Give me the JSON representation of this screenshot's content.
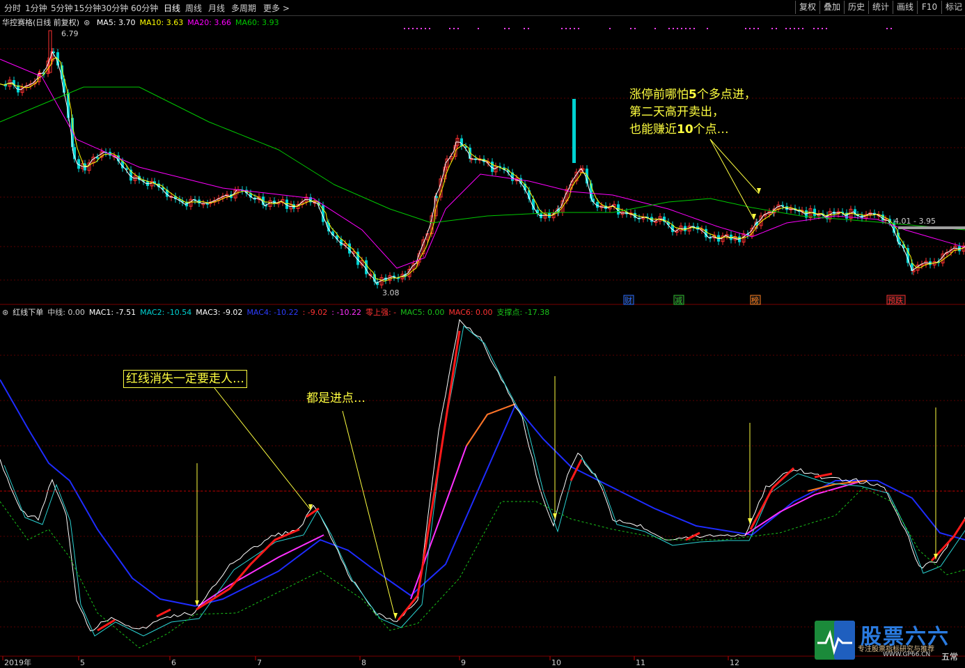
{
  "toolbar": {
    "periods": [
      "分时",
      "1分钟",
      "5分钟",
      "15分钟",
      "30分钟",
      "60分钟",
      "日线",
      "周线",
      "月线",
      "多周期",
      "更多 >"
    ],
    "active_period": "日线",
    "right_buttons": [
      "复权",
      "叠加",
      "历史",
      "统计",
      "画线",
      "F10",
      "标记"
    ]
  },
  "main_header": {
    "title": "华控赛格(日线 前复权)",
    "ma5": "MA5: 3.70",
    "ma10": "MA10: 3.63",
    "ma20": "MA20: 3.66",
    "ma60": "MA60: 3.93"
  },
  "main_labels": {
    "high": "6.79",
    "low": "3.08",
    "range": "4.01 - 3.95"
  },
  "event_markers": [
    "财",
    "减",
    "榜",
    "预跌"
  ],
  "indicator_header": {
    "name": "红线下单",
    "zhongxian": "中线: 0.00",
    "mac1": "MAC1: -7.51",
    "mac2": "MAC2: -10.54",
    "mac3": "MAC3: -9.02",
    "mac4": "MAC4: -10.22",
    "v5": ": -9.02",
    "v6": ": -10.22",
    "zero": "零上强: -",
    "mac5": "MAC5: 0.00",
    "mac6": "MAC6: 0.00",
    "support": "支撑点: -17.38"
  },
  "annotations": {
    "top_line1_a": "涨停前哪怕",
    "top_line1_b": "5",
    "top_line1_c": "个多点进，",
    "top_line2": "第二天高开卖出，",
    "top_line3_a": "也能赚近",
    "top_line3_b": "10",
    "top_line3_c": "个点…",
    "red_line": "红线消失一定要走人…",
    "entry": "都是进点…"
  },
  "x_axis": [
    "2019年",
    "5",
    "6",
    "7",
    "8",
    "9",
    "10",
    "11",
    "12"
  ],
  "watermark": {
    "brand": "股票六六",
    "slogan": "专注股票指标研究与推荐",
    "url": "WWW.GP66.CN"
  },
  "corner_text": "五常",
  "colors": {
    "up": "#ff3232",
    "down": "#00d2d2",
    "ma5": "#ffffff",
    "ma10": "#ffff00",
    "ma20": "#ff00ff",
    "ma60": "#00c800",
    "mac_blue": "#1e2cff",
    "mac_magenta": "#ff30ff",
    "mac_orange": "#ff7a1a",
    "red_line": "#ff1a1a",
    "support": "#19c319",
    "annotation": "#ffff40"
  }
}
